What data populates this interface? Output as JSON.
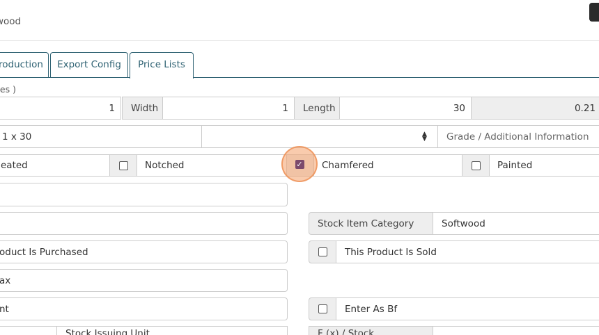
{
  "header": {
    "breadcrumb": "wood"
  },
  "tabs": [
    {
      "label": "roduction"
    },
    {
      "label": "Export Config"
    },
    {
      "label": "Price Lists"
    }
  ],
  "dimensions": {
    "section_label": "hes )",
    "thickness_value": "1",
    "width_label": "Width",
    "width_value": "1",
    "length_label": "Length",
    "length_value": "30",
    "board_feet_value": "0.21"
  },
  "size_row": {
    "size_text": "1 x 30",
    "select_value": "",
    "grade_placeholder": "Grade / Additional Information"
  },
  "options": {
    "treated_label": "eated",
    "notched_label": "Notched",
    "chamfered_label": "Chamfered",
    "painted_label": "Painted"
  },
  "form": {
    "stock_item_category_label": "Stock Item Category",
    "stock_item_category_value": "Softwood",
    "product_is_purchased_label": "oduct Is Purchased",
    "this_product_is_sold_label": "This Product Is Sold",
    "tax_label": "ax",
    "amount_label": "nt",
    "enter_as_bf_label": "Enter As Bf",
    "stock_unit_label": "Stock Issuing Unit",
    "stock_ratio_label": "F (x) / Stock"
  },
  "colors": {
    "tab_accent": "#2f6273",
    "checkbox_checked": "#7b4a6c",
    "focus_highlight": "#f4a069"
  }
}
